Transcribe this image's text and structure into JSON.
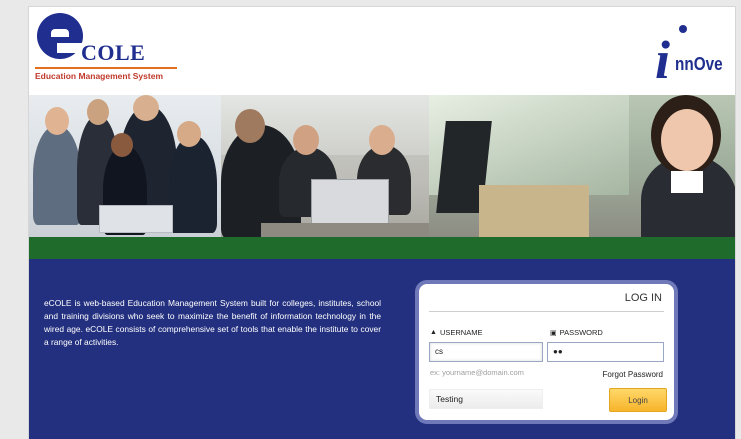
{
  "brand": {
    "logo_text": "COLE",
    "logo_subtitle": "Education Management System",
    "partner_logo": "nnOve"
  },
  "banner": {
    "colors": {
      "green_bar": "#1f6b2b"
    }
  },
  "main": {
    "description": "eCOLE is web-based Education Management System built for colleges, institutes, school and training divisions who seek to maximize the benefit of information technology in the wired age. eCOLE consists of comprehensive set of tools that enable the institute to cover a range of activities.",
    "colors": {
      "background": "#23307f"
    }
  },
  "login": {
    "title": "LOG IN",
    "username_label": "USERNAME",
    "password_label": "PASSWORD",
    "username_value": "cs",
    "password_value": "●●",
    "username_hint": "ex: yourname@domain.com",
    "forgot_password": "Forgot Password",
    "captcha_value": "Testing",
    "login_button": "Login",
    "icons": {
      "username": "user-icon",
      "password": "lock-icon"
    }
  }
}
